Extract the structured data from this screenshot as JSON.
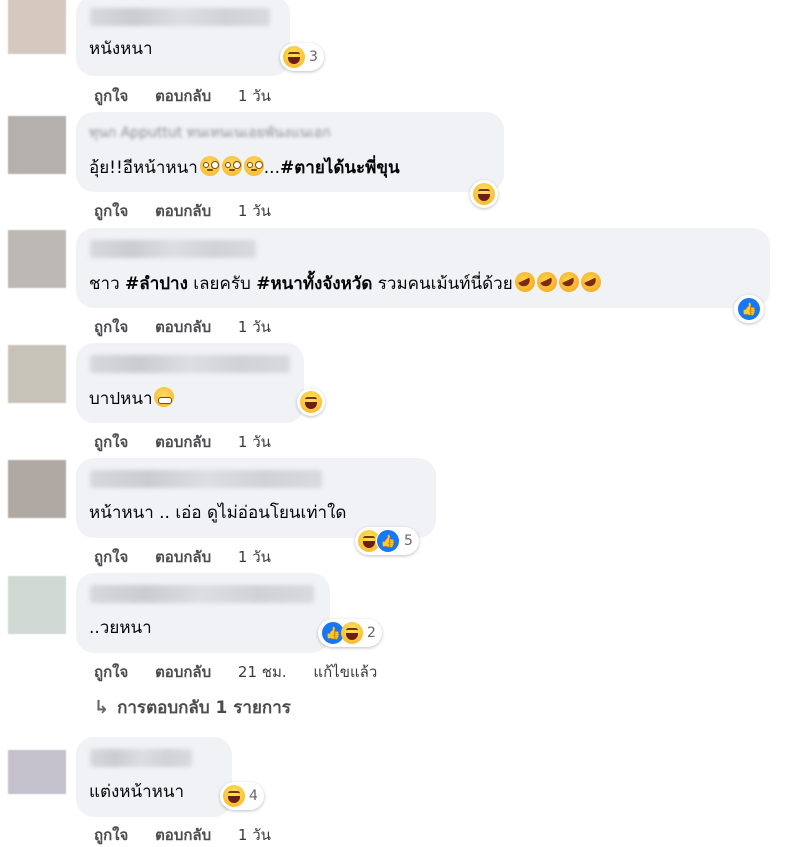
{
  "comments": [
    {
      "text": "หนังหนา",
      "reactions": [
        "haha"
      ],
      "count": "3",
      "time": "1 วัน",
      "avatar_color": "#d4c8bf"
    },
    {
      "name_partial": "ทุนก Apputtut ทนเทนเนเอยพันงแนเอก",
      "text_plain": "อุ้ย!!อีหน้าหนา",
      "text_dots": "...",
      "text_bold": "#ตายได้นะพี่ขุน",
      "reactions": [
        "haha"
      ],
      "count": "",
      "time": "1 วัน",
      "avatar_color": "#b3b0ae"
    },
    {
      "text_a": "ชาว ",
      "text_b": "#ลำปาง",
      "text_c": " เลยครับ ",
      "text_d": "#หนาทั้งจังหวัด",
      "text_e": " รวมคนเม้นท์นี่ด้วย",
      "reactions": [
        "like"
      ],
      "count": "",
      "time": "1 วัน",
      "avatar_color": "#bdb8b4"
    },
    {
      "text": "บาปหนา",
      "reactions": [
        "haha"
      ],
      "count": "",
      "time": "1 วัน",
      "avatar_color": "#c7c3b8"
    },
    {
      "text": "หน้าหนา .. เอ่อ ดูไม่อ่อนโยนเท่าใด",
      "reactions": [
        "haha",
        "like"
      ],
      "count": "5",
      "time": "1 วัน",
      "avatar_color": "#b0a9a3"
    },
    {
      "text": "..วยหนา",
      "reactions": [
        "like",
        "haha"
      ],
      "count": "2",
      "time": "21 ชม.",
      "edited": "แก้ไขแล้ว",
      "avatar_color": "#cfd8d3"
    },
    {
      "text": "แต่งหน้าหนา",
      "reactions": [
        "haha"
      ],
      "count": "4",
      "time": "1 วัน",
      "avatar_color": "#c4c0cc"
    }
  ],
  "actions": {
    "like_label": "ถูกใจ",
    "reply_label": "ตอบกลับ"
  },
  "replies_link": {
    "icon": "reply-arrow-icon",
    "label": "การตอบกลับ 1 รายการ"
  },
  "colors": {
    "bubble": "#f0f2f5",
    "like_blue": "#1877f2",
    "haha_yellow": "#f7b125"
  }
}
